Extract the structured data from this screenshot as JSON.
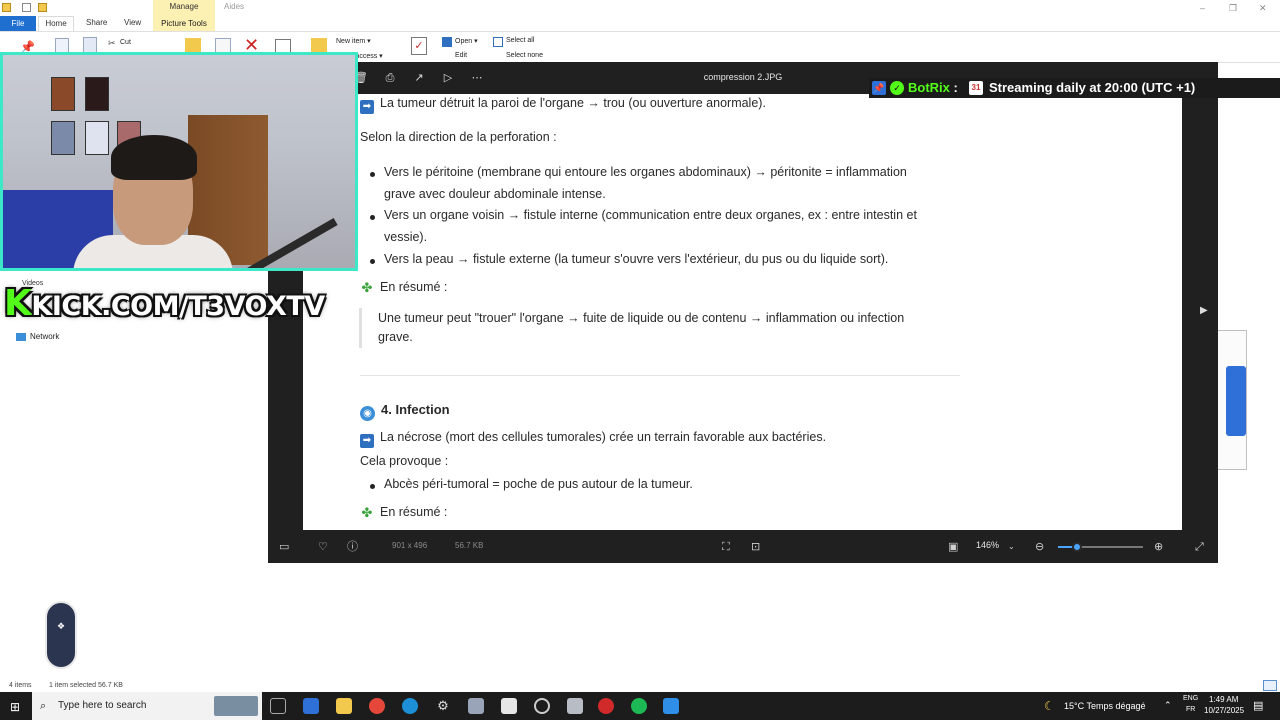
{
  "explorer": {
    "title_tabs": {
      "manage": "Manage",
      "aides": "Aides"
    },
    "ribbon_tabs": [
      "File",
      "Home",
      "Share",
      "View",
      "Picture Tools"
    ],
    "ribbon": {
      "cut": "Cut",
      "new_item": "New item ▾",
      "easy_access": "y access ▾",
      "open": "Open ▾",
      "edit": "Edit",
      "select_all": "Select all",
      "select_none": "Select none"
    },
    "nav": {
      "videos": "Videos",
      "network": "Network"
    },
    "status": {
      "items": "4 items",
      "selected": "1 item selected  56.7 KB"
    }
  },
  "viewer": {
    "title": "compression 2.JPG",
    "dimensions": "901 x 496",
    "file_size": "56.7 KB",
    "zoom": "146%",
    "zoom_fraction": 0.22
  },
  "document": {
    "line1": "La tumeur détruit la paroi de l'organe → trou (ou ouverture anormale).",
    "line2": "Selon la direction de la perforation :",
    "bullets1": [
      [
        "Vers le péritoine (membrane qui entoure les organes abdominaux) → péritonite = inflammation",
        "grave avec douleur abdominale intense."
      ],
      [
        "Vers un organe voisin → fistule interne (communication entre deux organes, ex : entre intestin et",
        "vessie)."
      ],
      [
        "Vers la peau → fistule externe (la tumeur s'ouvre vers l'extérieur, du pus ou du liquide sort)."
      ]
    ],
    "summary_label": "En résumé :",
    "quote": [
      "Une tumeur peut \"trouer\" l'organe → fuite de liquide ou de contenu → inflammation ou infection",
      "grave."
    ],
    "section_title": "4. Infection",
    "line3": "La nécrose (mort des cellules tumorales) crée un terrain favorable aux bactéries.",
    "line4": "Cela provoque :",
    "bullet2": "Abcès péri-tumoral = poche de pus autour de la tumeur.",
    "summary_label2": "En résumé :"
  },
  "overlay": {
    "kick_k": "K",
    "kick_text": "KICK.COM/T3VOXTV",
    "botrix_name": "BotRix",
    "botrix_colon": " : ",
    "botrix_calendar": "31",
    "botrix_message": "Streaming daily at 20:00 (UTC +1)"
  },
  "taskbar": {
    "search_placeholder": "Type here to search",
    "weather": "15°C  Temps dégagé",
    "lang_top": "ENG",
    "lang_bottom": "FR",
    "time": "1:49 AM",
    "date": "10/27/2025"
  },
  "colors": {
    "kick_green": "#53fc18",
    "webcam_border": "#3de8c9",
    "accent_blue": "#1f6fd0",
    "zoom_blue": "#4aa3ff"
  }
}
